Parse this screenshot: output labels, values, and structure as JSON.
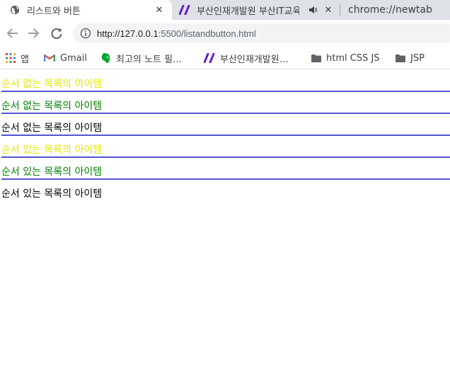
{
  "tabs": [
    {
      "title": "리스트와 버튼",
      "icon": "globe-icon",
      "active": true
    },
    {
      "title": "부산인재개발원 부산IT교육",
      "icon": "slash-logo-icon",
      "playing_audio": true
    },
    {
      "title": "chrome://newtab"
    }
  ],
  "toolbar": {
    "url_host": "http://127.0.0.1",
    "url_path": ":5500/listandbutton.html"
  },
  "bookmarks": [
    {
      "label": "앱",
      "icon": "apps-grid-icon"
    },
    {
      "label": "Gmail",
      "icon": "gmail-icon"
    },
    {
      "label": "최고의 노트 필…",
      "icon": "evernote-icon"
    },
    {
      "label": "부산인재개발원…",
      "icon": "slash-logo-icon"
    },
    {
      "label": "html CSS JS",
      "icon": "folder-icon"
    },
    {
      "label": "JSP",
      "icon": "folder-icon"
    }
  ],
  "colors": {
    "yellow": "#e6e600",
    "green": "#008000",
    "black": "#000000",
    "border": "#5454d4"
  },
  "list_items": [
    {
      "text": "순서 없는 목록의 아이템",
      "color": "#e6e600"
    },
    {
      "text": "순서 없는 목록의 아이템",
      "color": "#008000"
    },
    {
      "text": "순서 없는 목록의 아이템",
      "color": "#000000"
    },
    {
      "text": "순서 있는 목록의 아이템",
      "color": "#e6e600"
    },
    {
      "text": "순서 있는 목록의 아이템",
      "color": "#008000"
    },
    {
      "text": "순서 있는 목록의 아이템",
      "color": "#000000"
    }
  ]
}
